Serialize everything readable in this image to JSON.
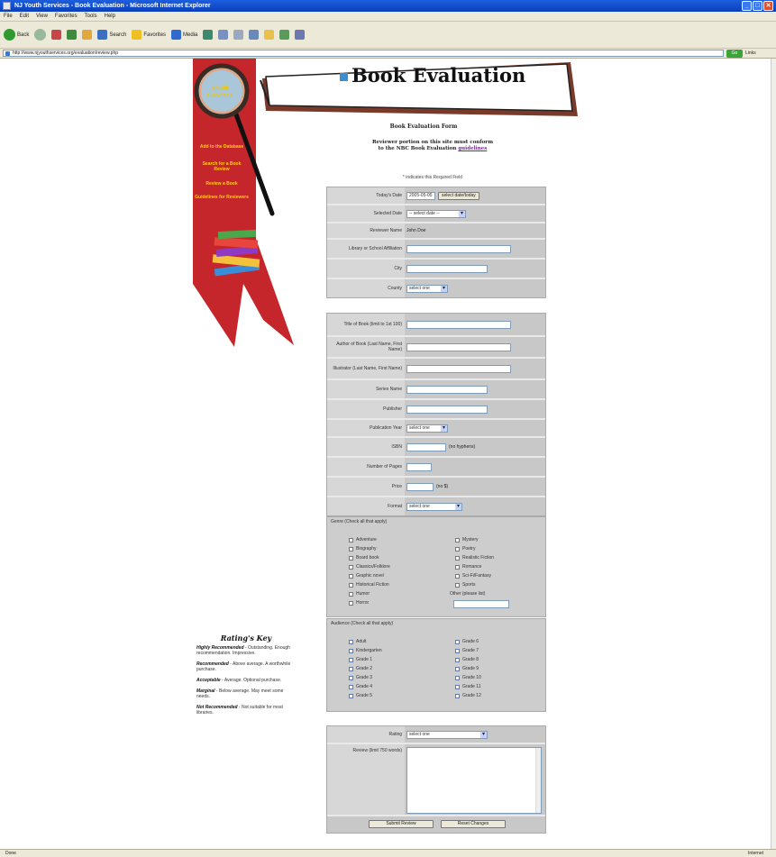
{
  "window": {
    "title": "NJ Youth Services - Book Evaluation - Microsoft Internet Explorer"
  },
  "menu": [
    "File",
    "Edit",
    "View",
    "Favorites",
    "Tools",
    "Help"
  ],
  "toolbar": {
    "back": "Back",
    "search": "Search",
    "favorites": "Favorites",
    "media": "Media"
  },
  "address": {
    "url": "http://www.njyouthservices.org/evaluation/review.php",
    "go": "Go",
    "links": "Links"
  },
  "banner": {
    "title": "Book Evaluation"
  },
  "ribbon": {
    "logo": "Youth Services",
    "links": [
      "Add to the Database",
      "Search for a Book Review",
      "Review a Book",
      "Guidelines for Reviewers"
    ]
  },
  "form": {
    "title": "Book Evaluation Form",
    "intro_line1": "Reviewer portion on this site must conform",
    "intro_line2": "to the NBC Book Evaluation",
    "intro_link": "guidelines",
    "required_note": "* indicates this Required Field",
    "reviewer": [
      {
        "label": "Today's Date",
        "value": "2005-05-05",
        "button": "select date/today"
      },
      {
        "label": "Selected Date",
        "select": "-- select date --"
      },
      {
        "label": "Reviewer Name",
        "value": "John Doe"
      },
      {
        "label": "Library or School Affiliation"
      },
      {
        "label": "City"
      },
      {
        "label": "County",
        "select": "select one"
      }
    ],
    "book": [
      {
        "label": "Title of Book (limit to 1st 100)"
      },
      {
        "label": "Author of Book (Last Name, First Name)"
      },
      {
        "label": "Illustrator (Last Name, First Name)"
      },
      {
        "label": "Series Name"
      },
      {
        "label": "Publisher"
      },
      {
        "label": "Publication Year",
        "select": "select one"
      },
      {
        "label": "ISBN",
        "suffix": "(no hyphens)"
      },
      {
        "label": "Number of Pages"
      },
      {
        "label": "Price",
        "suffix": "(no $)"
      },
      {
        "label": "Format",
        "select": "select one"
      }
    ],
    "genre": {
      "title": "Genre (Check all that apply)",
      "col1": [
        "Adventure",
        "Biography",
        "Board book",
        "Classics/Folklore",
        "Graphic novel",
        "Historical Fiction",
        "Humor",
        "Horror"
      ],
      "col2": [
        "Mystery",
        "Poetry",
        "Realistic Fiction",
        "Romance",
        "Sci-Fi/Fantasy",
        "Sports"
      ],
      "other_label": "Other (please list)"
    },
    "audience": {
      "title": "Audience (Check all that apply)",
      "col1": [
        "Adult",
        "Kindergarten",
        "Grade 1",
        "Grade 2",
        "Grade 3",
        "Grade 4",
        "Grade 5"
      ],
      "col2": [
        "Grade 6",
        "Grade 7",
        "Grade 8",
        "Grade 9",
        "Grade 10",
        "Grade 11",
        "Grade 12"
      ]
    },
    "rating": {
      "label": "Rating",
      "select": "select one"
    },
    "review": {
      "label": "Review (limit 750 words)"
    },
    "buttons": {
      "submit": "Submit Review",
      "reset": "Reset Changes"
    }
  },
  "ratings_key": {
    "title": "Rating's Key",
    "items": [
      {
        "term": "Highly Recommended",
        "desc": "- Outstanding. Enough recommendation. Impressive."
      },
      {
        "term": "Recommended",
        "desc": "- Above average. A worthwhile purchase."
      },
      {
        "term": "Acceptable",
        "desc": "- Average. Optional purchase."
      },
      {
        "term": "Marginal",
        "desc": "- Below average. May meet some needs."
      },
      {
        "term": "Not Recommended",
        "desc": "- Not suitable for most libraries."
      }
    ]
  },
  "status": {
    "text": "Done",
    "zone": "Internet"
  },
  "colors": {
    "ribbon": "#c4262b",
    "link_yellow": "#ffd400",
    "form_bg": "#c8c8c8",
    "xp_blue": "#0a3fb8"
  }
}
